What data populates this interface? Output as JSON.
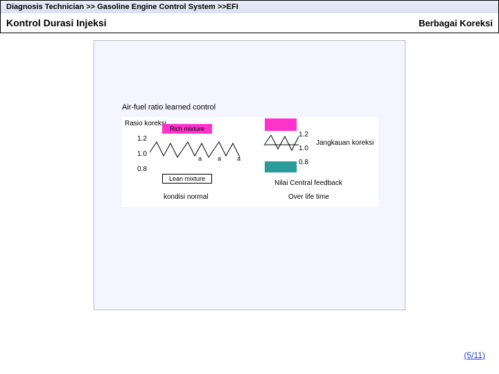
{
  "breadcrumb": "Diagnosis Technician >> Gasoline Engine Control System >>EFI",
  "page_title": "Kontrol Durasi Injeksi",
  "page_subtitle": "Berbagai Koreksi",
  "section_label": "Air-fuel ratio learned control",
  "diagram": {
    "y_label_left": "Rasio koreksi",
    "ticks_left": {
      "t12": "1.2",
      "t10": "1.0",
      "t08": "0.8"
    },
    "rich_label": "Rich mixture",
    "lean_label": "Lean mixture",
    "small_a": "a",
    "ticks_right": {
      "t12": "1.2",
      "t10": "1.0",
      "t08": "0.8"
    },
    "right_label": "Jangkauan koreksi",
    "feedback_label": "Nilai Central feedback",
    "col_left": "kondisi normal",
    "col_right": "Over life time"
  },
  "pagination": "(5/11)",
  "chart_data": {
    "type": "line",
    "title": "Air-fuel ratio learned control",
    "ylabel": "Rasio koreksi",
    "ylim": [
      0.8,
      1.2
    ],
    "series": [
      {
        "name": "kondisi normal",
        "mean": 1.0,
        "amplitude": 0.1,
        "pattern": "sawtooth"
      },
      {
        "name": "Over life time",
        "mean": 1.1,
        "amplitude": 0.1,
        "pattern": "sawtooth"
      }
    ],
    "annotations": [
      "Rich mixture",
      "Lean mixture",
      "Jangkauan koreksi",
      "Nilai Central feedback"
    ]
  }
}
